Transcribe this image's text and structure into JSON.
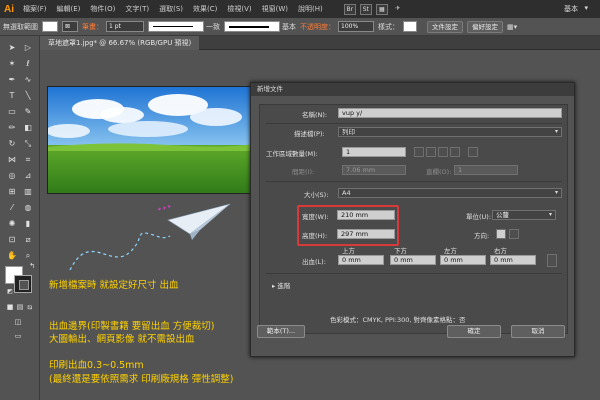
{
  "app": {
    "logo": "Ai",
    "menus": [
      "檔案(F)",
      "編輯(E)",
      "物件(O)",
      "文字(T)",
      "選取(S)",
      "效果(C)",
      "檢視(V)",
      "視窗(W)",
      "說明(H)"
    ],
    "workspace": "基本"
  },
  "controlbar": {
    "selection": "無選取範圍",
    "stroke_label": "筆畫：",
    "stroke_value": "1 pt",
    "profile_label": "一致",
    "brush_label": "基本",
    "opacity_label": "不透明度：",
    "opacity_value": "100%",
    "style_label": "樣式：",
    "doc_setup_button": "文件設定",
    "preferences_button": "偏好設定"
  },
  "document": {
    "tab_title": "草地遮罩1.jpg* @ 66.67% (RGB/GPU 預視)"
  },
  "notes": {
    "line1": "新增檔案時  就設定好尺寸  出血",
    "line2": "出血邊界(印製書籍  要留出血  方便裁切)",
    "line3": "大圖輸出、網頁影像  就不需設出血",
    "line4": "印刷出血0.3~0.5mm",
    "line5": "(最終還是要依照需求  印刷廠規格  彈性調整)"
  },
  "dialog": {
    "title": "新增文件",
    "name_label": "名稱(N):",
    "name_value": "vup y/",
    "profile_label": "描述檔(P):",
    "profile_value": "列印",
    "artboards_label": "工作區域數量(M):",
    "artboards_value": "1",
    "spacing_label": "間距(I):",
    "spacing_value": "7.06 mm",
    "columns_label": "直欄(O):",
    "columns_value": "1",
    "size_label": "大小(S):",
    "size_value": "A4",
    "width_label": "寬度(W):",
    "width_value": "210 mm",
    "height_label": "高度(H):",
    "height_value": "297 mm",
    "units_label": "單位(U):",
    "units_value": "公釐",
    "orientation_label": "方向:",
    "bleed_label": "出血(L):",
    "bleed_top_label": "上方",
    "bleed_bottom_label": "下方",
    "bleed_left_label": "左方",
    "bleed_right_label": "右方",
    "bleed_top": "0 mm",
    "bleed_bottom": "0 mm",
    "bleed_left": "0 mm",
    "bleed_right": "0 mm",
    "advanced_label": "進階",
    "color_info": "色彩模式：CMYK, PPI:300, 對齊像素格點：否",
    "templates_button": "範本(T)...",
    "ok_button": "確定",
    "cancel_button": "取消"
  },
  "colors": {
    "note_text": "#ffd200",
    "highlight_border": "#d83a3a",
    "accent": "#ff9a00"
  }
}
